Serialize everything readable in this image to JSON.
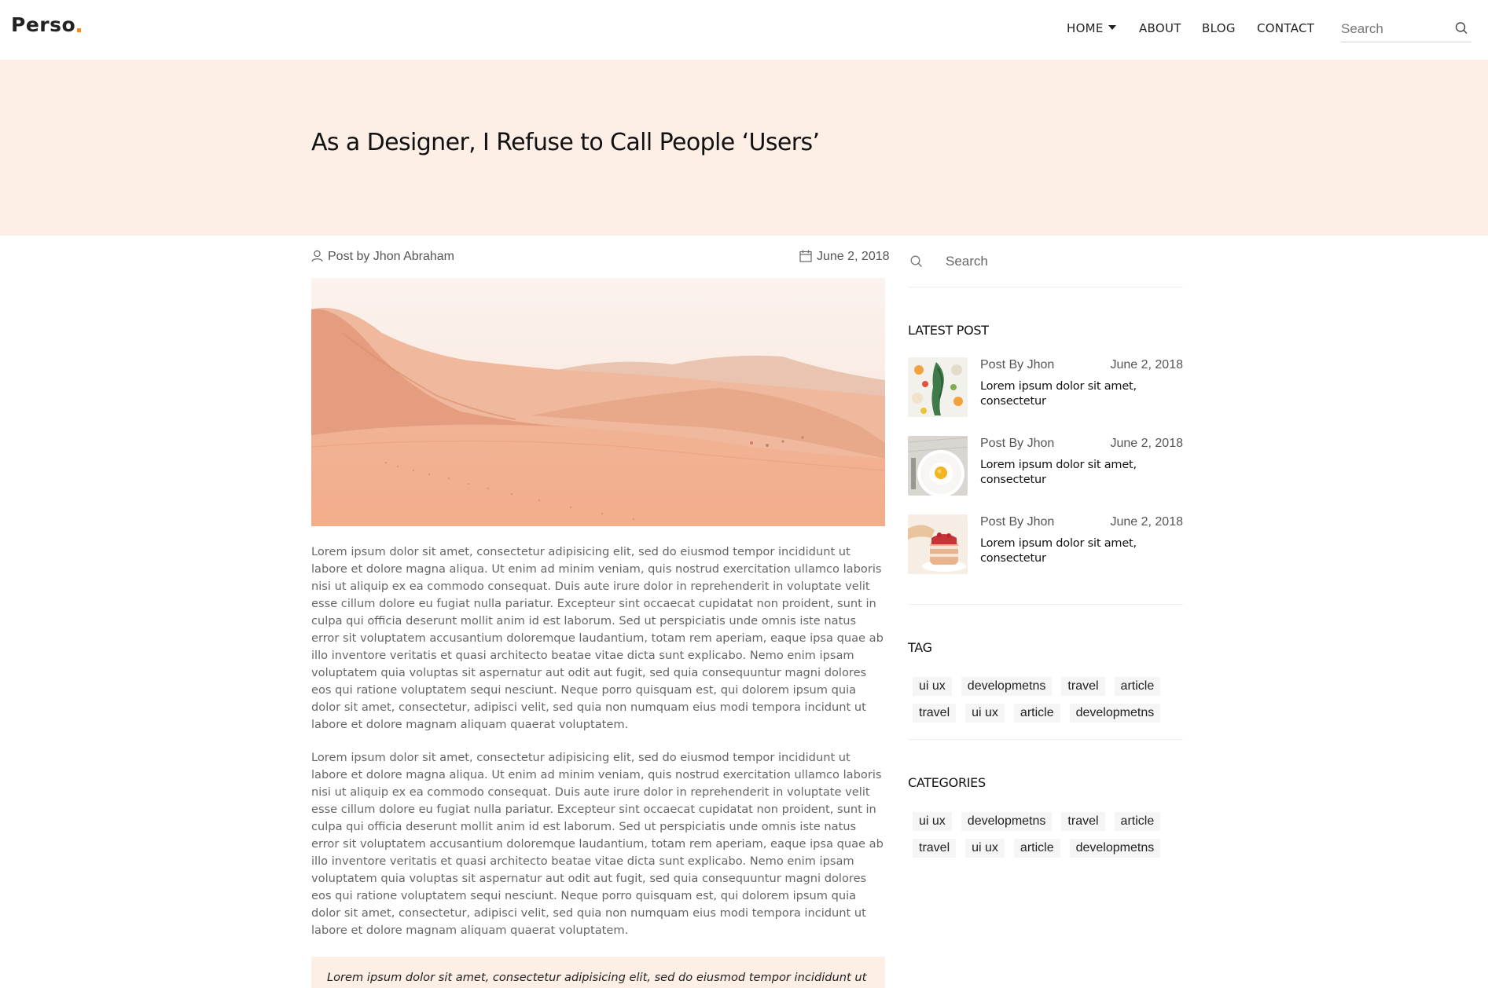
{
  "nav": {
    "logo": "Perso",
    "items": [
      {
        "label": "HOME",
        "dropdown": true
      },
      {
        "label": "ABOUT"
      },
      {
        "label": "BLOG"
      },
      {
        "label": "CONTACT"
      }
    ],
    "search_placeholder": "Search"
  },
  "hero": {
    "title": "As a Designer, I Refuse to Call People ‘Users’"
  },
  "post": {
    "author": "Post by Jhon Abraham",
    "date": "June 2, 2018",
    "paragraphs": [
      "Lorem ipsum dolor sit amet, consectetur adipisicing elit, sed do eiusmod tempor incididunt ut labore et dolore magna aliqua. Ut enim ad minim veniam, quis nostrud exercitation ullamco laboris nisi ut aliquip ex ea commodo consequat. Duis aute irure dolor in reprehenderit in voluptate velit esse cillum dolore eu fugiat nulla pariatur. Excepteur sint occaecat cupidatat non proident, sunt in culpa qui officia deserunt mollit anim id est laborum. Sed ut perspiciatis unde omnis iste natus error sit voluptatem accusantium doloremque laudantium, totam rem aperiam, eaque ipsa quae ab illo inventore veritatis et quasi architecto beatae vitae dicta sunt explicabo. Nemo enim ipsam voluptatem quia voluptas sit aspernatur aut odit aut fugit, sed quia consequuntur magni dolores eos qui ratione voluptatem sequi nesciunt. Neque porro quisquam est, qui dolorem ipsum quia dolor sit amet, consectetur, adipisci velit, sed quia non numquam eius modi tempora incidunt ut labore et dolore magnam aliquam quaerat voluptatem.",
      "Lorem ipsum dolor sit amet, consectetur adipisicing elit, sed do eiusmod tempor incididunt ut labore et dolore magna aliqua. Ut enim ad minim veniam, quis nostrud exercitation ullamco laboris nisi ut aliquip ex ea commodo consequat. Duis aute irure dolor in reprehenderit in voluptate velit esse cillum dolore eu fugiat nulla pariatur. Excepteur sint occaecat cupidatat non proident, sunt in culpa qui officia deserunt mollit anim id est laborum. Sed ut perspiciatis unde omnis iste natus error sit voluptatem accusantium doloremque laudantium, totam rem aperiam, eaque ipsa quae ab illo inventore veritatis et quasi architecto beatae vitae dicta sunt explicabo. Nemo enim ipsam voluptatem quia voluptas sit aspernatur aut odit aut fugit, sed quia consequuntur magni dolores eos qui ratione voluptatem sequi nesciunt. Neque porro quisquam est, qui dolorem ipsum quia dolor sit amet, consectetur, adipisci velit, sed quia non numquam eius modi tempora incidunt ut labore et dolore magnam aliquam quaerat voluptatem."
    ],
    "quote": "Lorem ipsum dolor sit amet, consectetur adipisicing elit, sed do eiusmod tempor incididunt ut"
  },
  "sidebar": {
    "search_placeholder": "Search",
    "latest_title": "LATEST POST",
    "latest": [
      {
        "author": "Post By Jhon",
        "date": "June 2, 2018",
        "title": "Lorem ipsum dolor sit amet, consectetur"
      },
      {
        "author": "Post By Jhon",
        "date": "June 2, 2018",
        "title": "Lorem ipsum dolor sit amet, consectetur"
      },
      {
        "author": "Post By Jhon",
        "date": "June 2, 2018",
        "title": "Lorem ipsum dolor sit amet, consectetur"
      }
    ],
    "tag_title": "TAG",
    "tags": [
      "ui ux",
      "developmetns",
      "travel",
      "article",
      "travel",
      "ui ux",
      "article",
      "developmetns"
    ],
    "categories_title": "CATEGORIES",
    "categories": [
      "ui ux",
      "developmetns",
      "travel",
      "article",
      "travel",
      "ui ux",
      "article",
      "developmetns"
    ]
  },
  "colors": {
    "accent": "#f58b1f",
    "hero_bg": "#fdeee6",
    "tag_bg": "#f5f5f5"
  }
}
